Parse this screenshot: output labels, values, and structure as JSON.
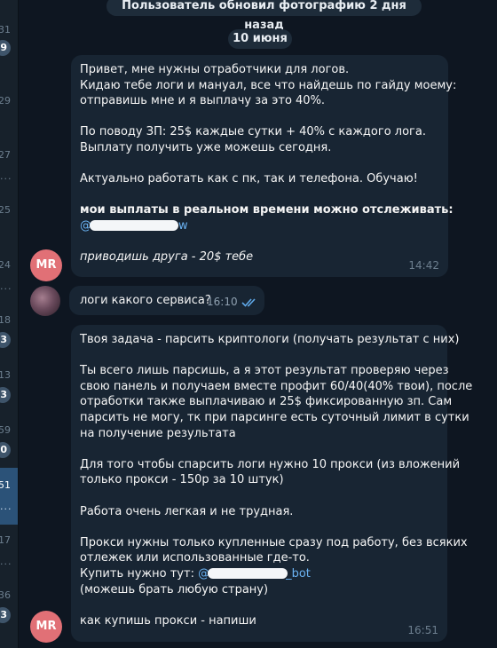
{
  "service_message": "Пользователь обновил фотографию 2 дня назад",
  "date_divider": "10 июня",
  "left_list": {
    "times": [
      "31",
      "29",
      "27",
      "25",
      "24",
      "18",
      "13",
      "59",
      "51",
      "17",
      "36"
    ],
    "badges": [
      "9",
      "3",
      "3",
      "0",
      "3"
    ],
    "dots": "..."
  },
  "messages": [
    {
      "author_initials": "MR",
      "lines": [
        "Привет, мне нужны отработчики для логов.",
        "Кидаю тебе логи и мануал, все что найдешь по гайду моему:",
        "отправишь мне и я выплачу за это 40%.",
        "",
        "По поводу ЗП: 25$ каждые сутки + 40% с каждого лога.",
        "Выплату получить уже можешь сегодня.",
        "",
        "Актуально работать как с пк, так и телефона. Обучаю!",
        "",
        "мои выплаты в реальном времени можно отслеживать:"
      ],
      "mention_prefix": "@",
      "mention_suffix": "w",
      "footer": "приводишь друга - 20$ тебе",
      "time": "14:42"
    },
    {
      "text": "логи какого сервиса?",
      "time": "16:10"
    },
    {
      "author_initials": "MR",
      "lines": [
        "Твоя задача - парсить криптологи (получать результат с них)",
        "",
        "Ты всего лишь парсишь, а я этот результат проверяю через",
        "свою панель и получаем вместе профит 60/40(40% твои), после",
        "отработки также выплачиваю и 25$ фиксированную зп. Сам",
        "парсить не могу, тк при парсинге есть суточный лимит в сутки",
        "на получение результата",
        "",
        "Для того чтобы спарсить логи нужно 10 прокси (из вложений",
        "только прокси - 150р за 10 штук)",
        "",
        "Работа очень легкая и не трудная.",
        "",
        "Прокси нужны только купленные сразу под работу, без всяких",
        "отлежек или использованные где-то."
      ],
      "buy_label": "Купить нужно тут: ",
      "buy_mention_prefix": "@",
      "buy_mention_suffix": "_bot",
      "after_lines": [
        "(можешь брать любую страну)",
        "",
        "как купишь прокси - напиши"
      ],
      "time": "16:51"
    }
  ]
}
